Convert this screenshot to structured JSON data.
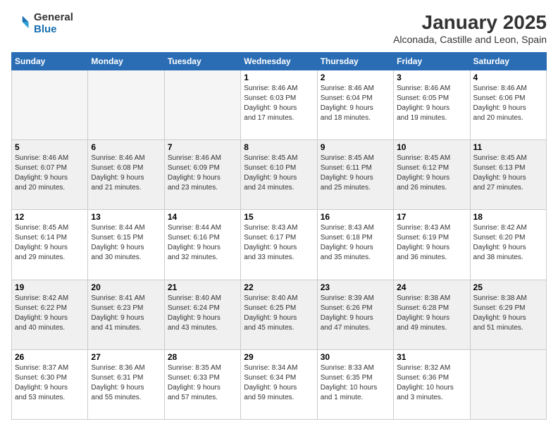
{
  "logo": {
    "line1": "General",
    "line2": "Blue"
  },
  "title": "January 2025",
  "subtitle": "Alconada, Castille and Leon, Spain",
  "header_days": [
    "Sunday",
    "Monday",
    "Tuesday",
    "Wednesday",
    "Thursday",
    "Friday",
    "Saturday"
  ],
  "weeks": [
    {
      "shaded": false,
      "days": [
        {
          "num": "",
          "info": ""
        },
        {
          "num": "",
          "info": ""
        },
        {
          "num": "",
          "info": ""
        },
        {
          "num": "1",
          "info": "Sunrise: 8:46 AM\nSunset: 6:03 PM\nDaylight: 9 hours\nand 17 minutes."
        },
        {
          "num": "2",
          "info": "Sunrise: 8:46 AM\nSunset: 6:04 PM\nDaylight: 9 hours\nand 18 minutes."
        },
        {
          "num": "3",
          "info": "Sunrise: 8:46 AM\nSunset: 6:05 PM\nDaylight: 9 hours\nand 19 minutes."
        },
        {
          "num": "4",
          "info": "Sunrise: 8:46 AM\nSunset: 6:06 PM\nDaylight: 9 hours\nand 20 minutes."
        }
      ]
    },
    {
      "shaded": true,
      "days": [
        {
          "num": "5",
          "info": "Sunrise: 8:46 AM\nSunset: 6:07 PM\nDaylight: 9 hours\nand 20 minutes."
        },
        {
          "num": "6",
          "info": "Sunrise: 8:46 AM\nSunset: 6:08 PM\nDaylight: 9 hours\nand 21 minutes."
        },
        {
          "num": "7",
          "info": "Sunrise: 8:46 AM\nSunset: 6:09 PM\nDaylight: 9 hours\nand 23 minutes."
        },
        {
          "num": "8",
          "info": "Sunrise: 8:45 AM\nSunset: 6:10 PM\nDaylight: 9 hours\nand 24 minutes."
        },
        {
          "num": "9",
          "info": "Sunrise: 8:45 AM\nSunset: 6:11 PM\nDaylight: 9 hours\nand 25 minutes."
        },
        {
          "num": "10",
          "info": "Sunrise: 8:45 AM\nSunset: 6:12 PM\nDaylight: 9 hours\nand 26 minutes."
        },
        {
          "num": "11",
          "info": "Sunrise: 8:45 AM\nSunset: 6:13 PM\nDaylight: 9 hours\nand 27 minutes."
        }
      ]
    },
    {
      "shaded": false,
      "days": [
        {
          "num": "12",
          "info": "Sunrise: 8:45 AM\nSunset: 6:14 PM\nDaylight: 9 hours\nand 29 minutes."
        },
        {
          "num": "13",
          "info": "Sunrise: 8:44 AM\nSunset: 6:15 PM\nDaylight: 9 hours\nand 30 minutes."
        },
        {
          "num": "14",
          "info": "Sunrise: 8:44 AM\nSunset: 6:16 PM\nDaylight: 9 hours\nand 32 minutes."
        },
        {
          "num": "15",
          "info": "Sunrise: 8:43 AM\nSunset: 6:17 PM\nDaylight: 9 hours\nand 33 minutes."
        },
        {
          "num": "16",
          "info": "Sunrise: 8:43 AM\nSunset: 6:18 PM\nDaylight: 9 hours\nand 35 minutes."
        },
        {
          "num": "17",
          "info": "Sunrise: 8:43 AM\nSunset: 6:19 PM\nDaylight: 9 hours\nand 36 minutes."
        },
        {
          "num": "18",
          "info": "Sunrise: 8:42 AM\nSunset: 6:20 PM\nDaylight: 9 hours\nand 38 minutes."
        }
      ]
    },
    {
      "shaded": true,
      "days": [
        {
          "num": "19",
          "info": "Sunrise: 8:42 AM\nSunset: 6:22 PM\nDaylight: 9 hours\nand 40 minutes."
        },
        {
          "num": "20",
          "info": "Sunrise: 8:41 AM\nSunset: 6:23 PM\nDaylight: 9 hours\nand 41 minutes."
        },
        {
          "num": "21",
          "info": "Sunrise: 8:40 AM\nSunset: 6:24 PM\nDaylight: 9 hours\nand 43 minutes."
        },
        {
          "num": "22",
          "info": "Sunrise: 8:40 AM\nSunset: 6:25 PM\nDaylight: 9 hours\nand 45 minutes."
        },
        {
          "num": "23",
          "info": "Sunrise: 8:39 AM\nSunset: 6:26 PM\nDaylight: 9 hours\nand 47 minutes."
        },
        {
          "num": "24",
          "info": "Sunrise: 8:38 AM\nSunset: 6:28 PM\nDaylight: 9 hours\nand 49 minutes."
        },
        {
          "num": "25",
          "info": "Sunrise: 8:38 AM\nSunset: 6:29 PM\nDaylight: 9 hours\nand 51 minutes."
        }
      ]
    },
    {
      "shaded": false,
      "days": [
        {
          "num": "26",
          "info": "Sunrise: 8:37 AM\nSunset: 6:30 PM\nDaylight: 9 hours\nand 53 minutes."
        },
        {
          "num": "27",
          "info": "Sunrise: 8:36 AM\nSunset: 6:31 PM\nDaylight: 9 hours\nand 55 minutes."
        },
        {
          "num": "28",
          "info": "Sunrise: 8:35 AM\nSunset: 6:33 PM\nDaylight: 9 hours\nand 57 minutes."
        },
        {
          "num": "29",
          "info": "Sunrise: 8:34 AM\nSunset: 6:34 PM\nDaylight: 9 hours\nand 59 minutes."
        },
        {
          "num": "30",
          "info": "Sunrise: 8:33 AM\nSunset: 6:35 PM\nDaylight: 10 hours\nand 1 minute."
        },
        {
          "num": "31",
          "info": "Sunrise: 8:32 AM\nSunset: 6:36 PM\nDaylight: 10 hours\nand 3 minutes."
        },
        {
          "num": "",
          "info": ""
        }
      ]
    }
  ]
}
